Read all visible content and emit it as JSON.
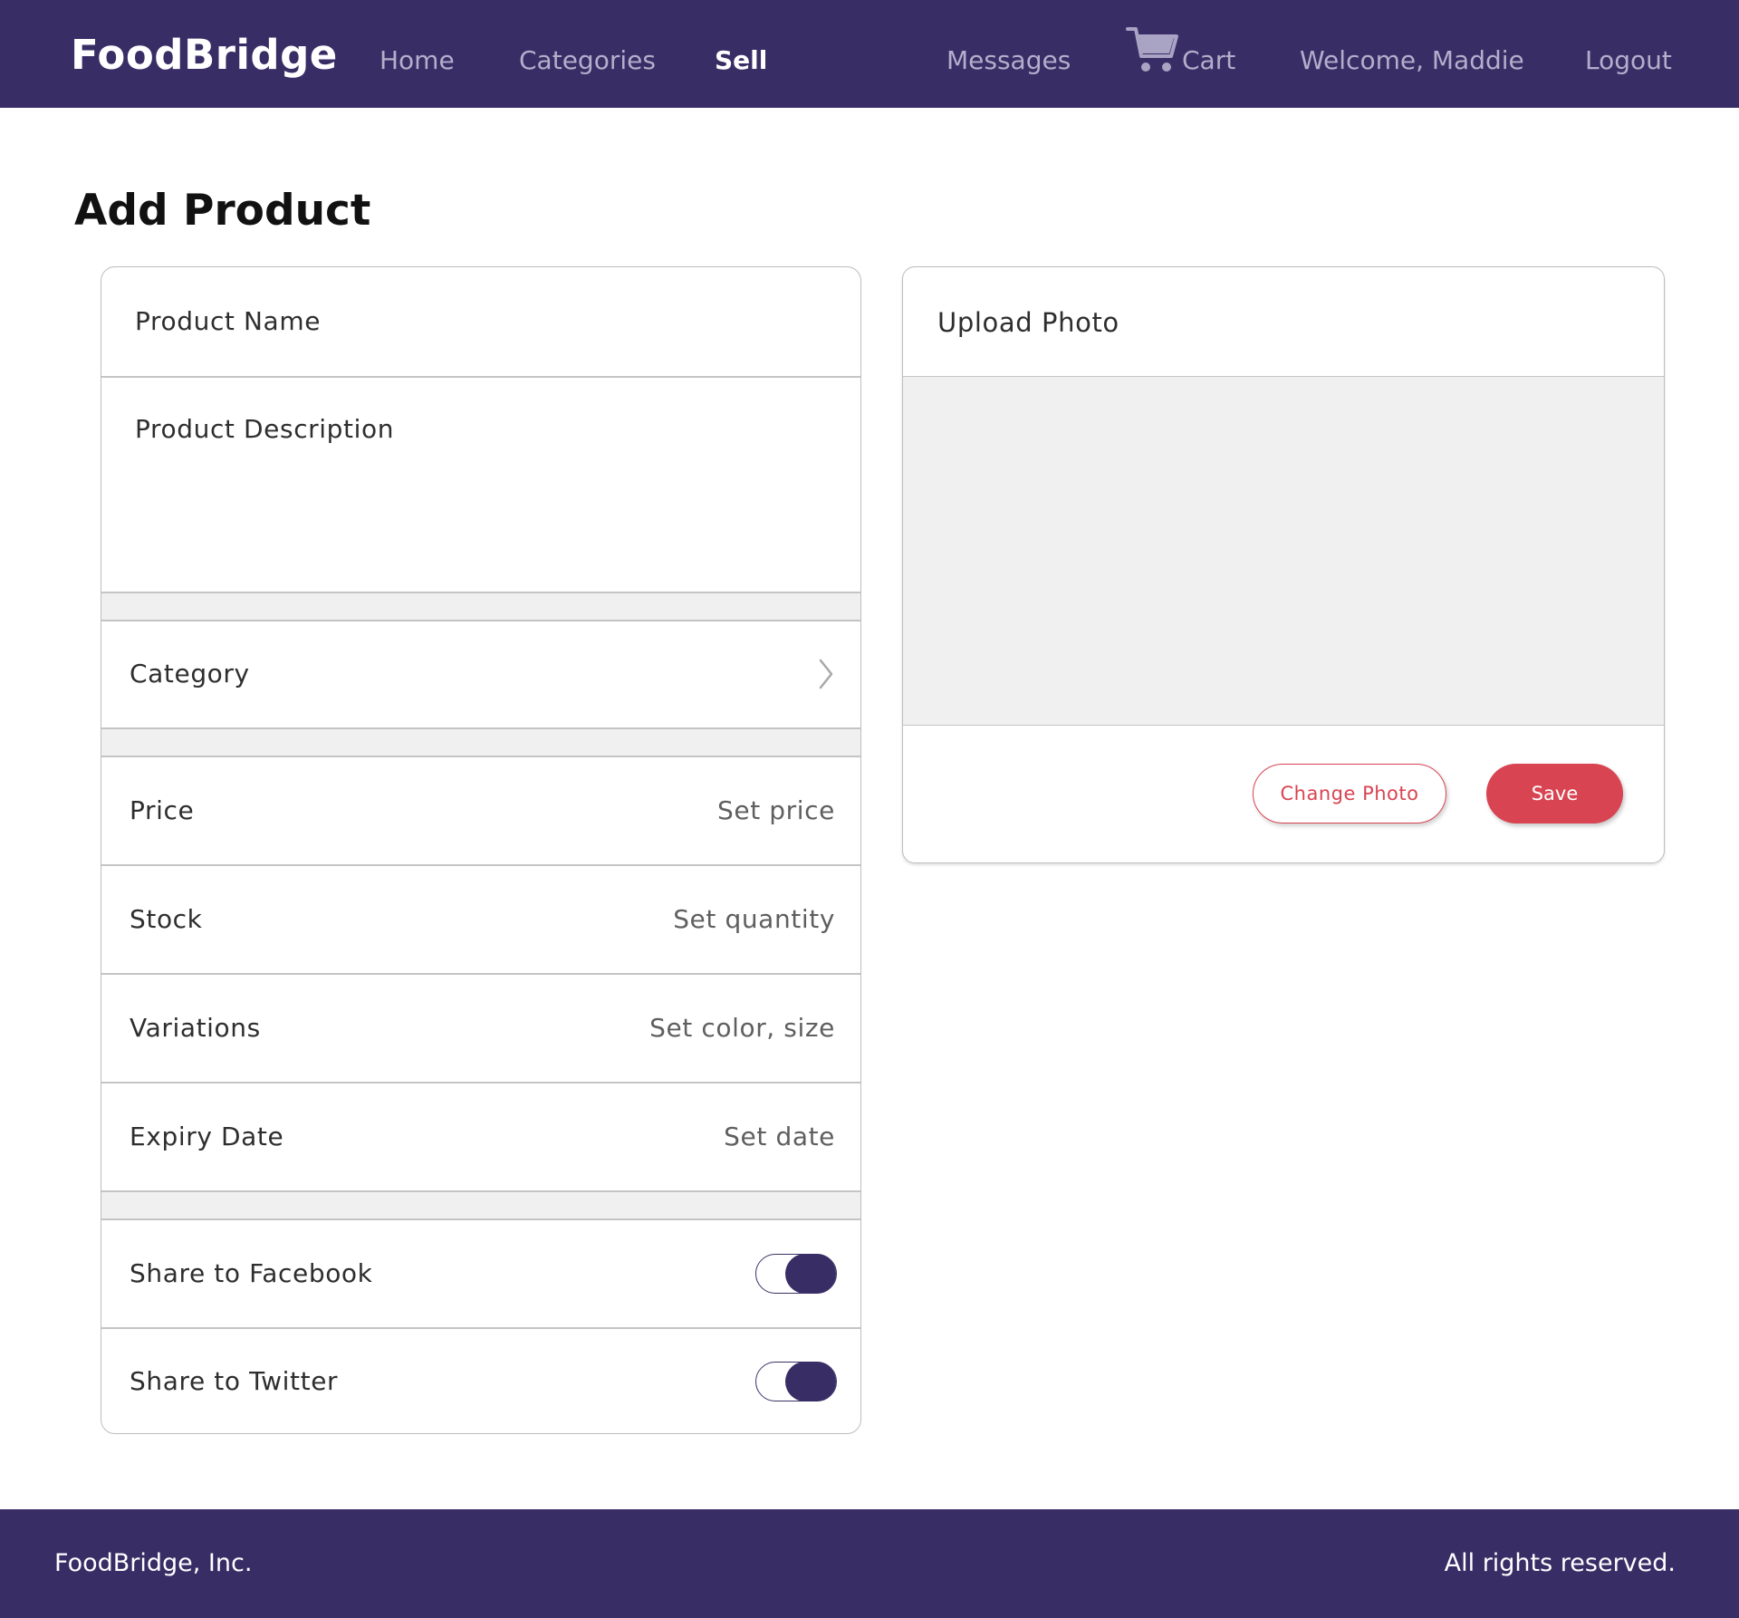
{
  "header": {
    "brand": "FoodBridge",
    "nav": {
      "home": "Home",
      "categories": "Categories",
      "sell": "Sell",
      "messages": "Messages",
      "cart": "Cart",
      "welcome": "Welcome, Maddie",
      "logout": "Logout"
    },
    "active_nav": "Sell",
    "cart_icon": "shopping-cart-icon"
  },
  "page": {
    "title": "Add Product"
  },
  "form": {
    "product_name": "Product Name",
    "product_description": "Product Description",
    "category": "Category",
    "category_icon": "chevron-right-icon",
    "price": {
      "label": "Price",
      "value": "Set price"
    },
    "stock": {
      "label": "Stock",
      "value": "Set quantity"
    },
    "variations": {
      "label": "Variations",
      "value": "Set color, size"
    },
    "expiry_date": {
      "label": "Expiry Date",
      "value": "Set date"
    },
    "share_facebook": {
      "label": "Share to Facebook",
      "on": true
    },
    "share_twitter": {
      "label": "Share to Twitter",
      "on": true
    }
  },
  "upload": {
    "title": "Upload Photo",
    "change_photo": "Change Photo",
    "save": "Save"
  },
  "footer": {
    "left": "FoodBridge, Inc.",
    "right": "All rights reserved."
  },
  "colors": {
    "primary": "#392d66",
    "accent": "#d84452",
    "nav_inactive": "#b3aecb",
    "panel_gray": "#eff0ef"
  }
}
